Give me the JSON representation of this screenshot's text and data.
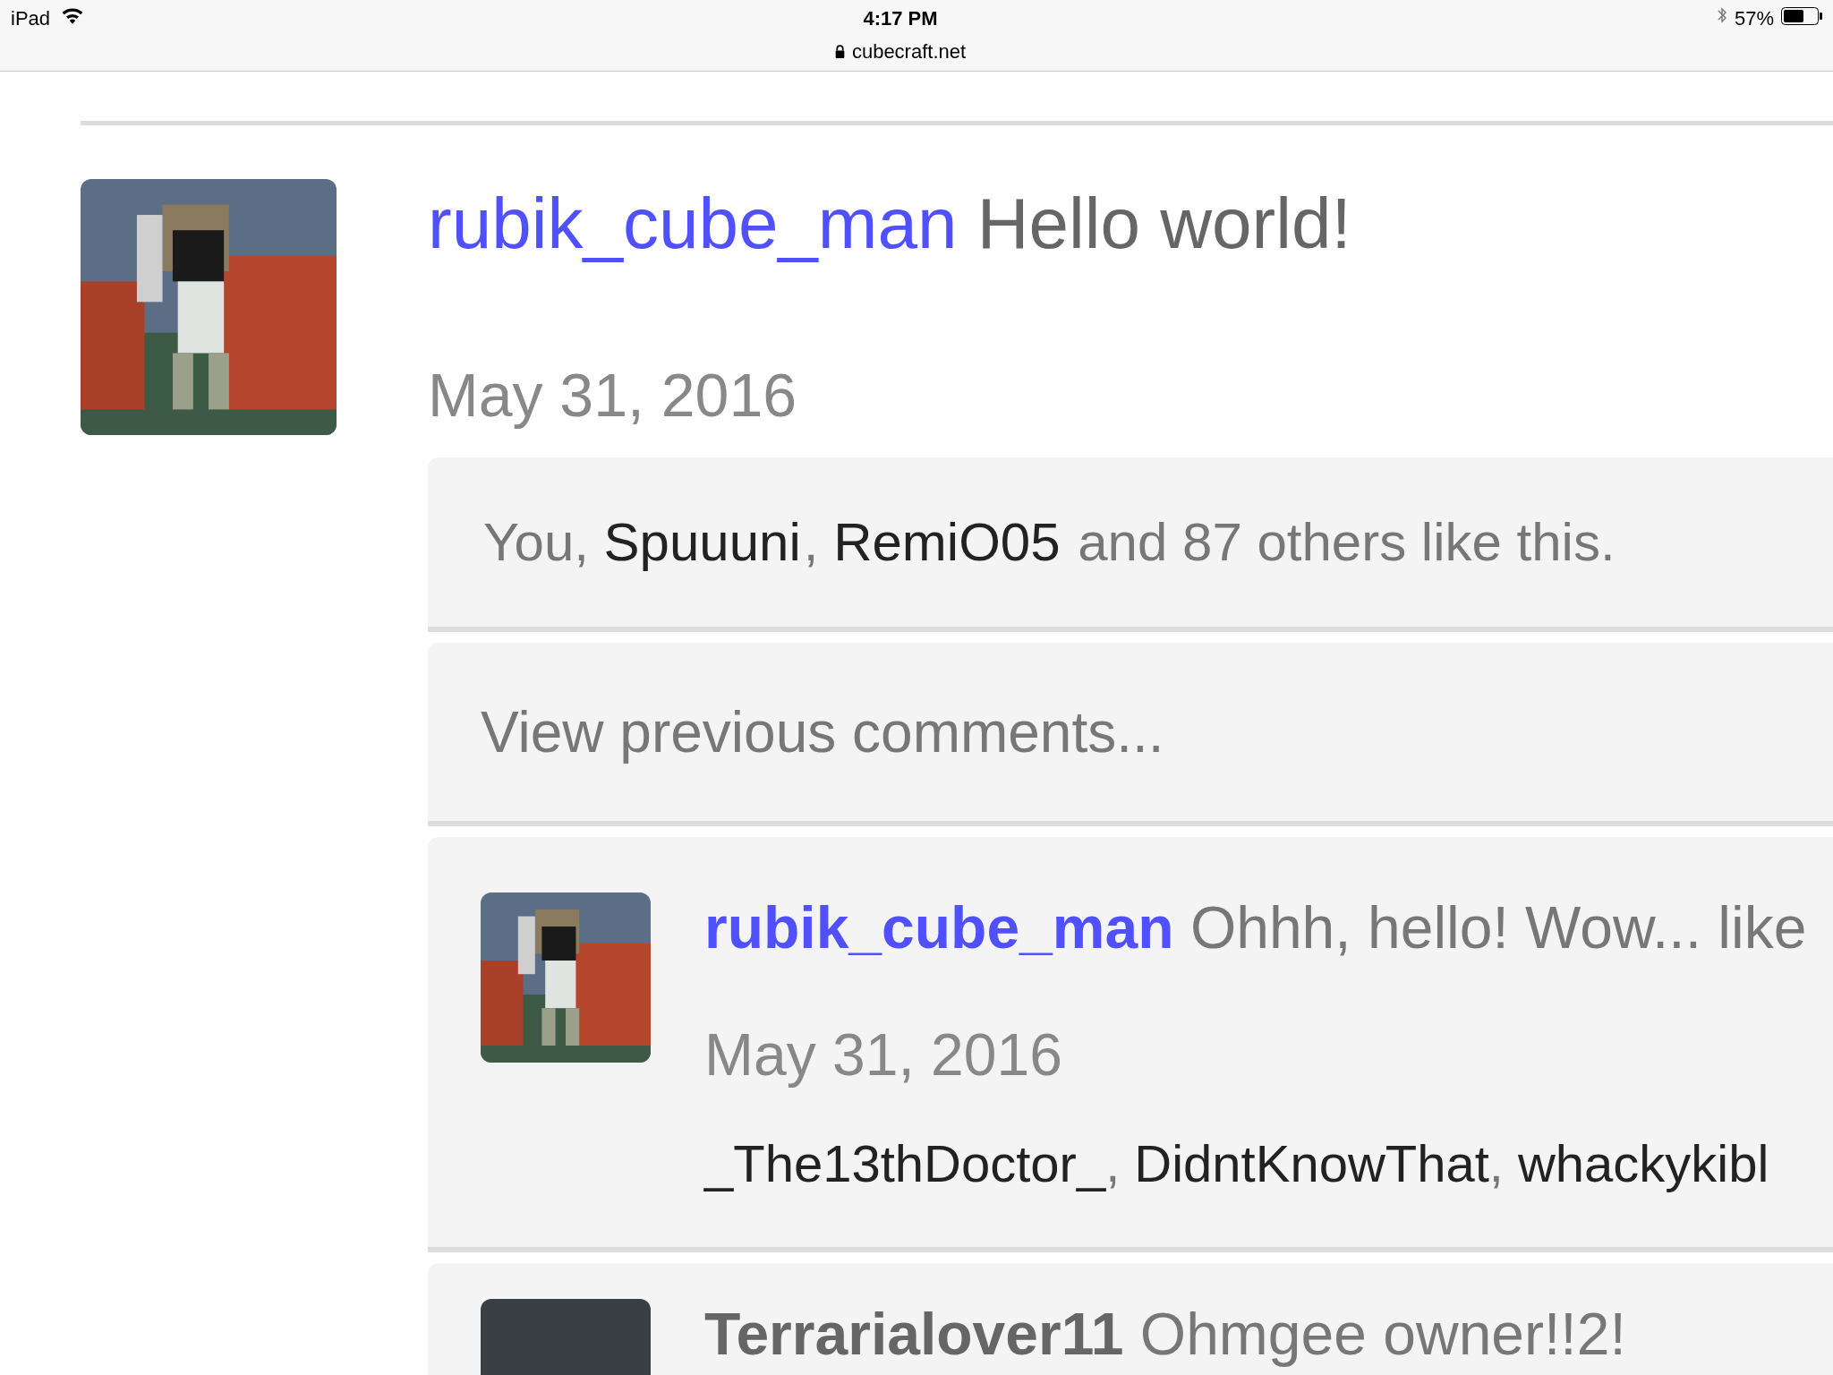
{
  "status_bar": {
    "device": "iPad",
    "time": "4:17 PM",
    "url": "cubecraft.net",
    "battery": "57%"
  },
  "post": {
    "author": "rubik_cube_man",
    "text": "Hello world!",
    "date": "May 31, 2016",
    "likes": [
      {
        "kind": "plain",
        "text": "You, "
      },
      {
        "kind": "link",
        "text": "Spuuuni"
      },
      {
        "kind": "plain",
        "text": ", "
      },
      {
        "kind": "link",
        "text": "RemiO05"
      },
      {
        "kind": "plain",
        "text": " and 87 others like this."
      }
    ],
    "view_previous": "View previous comments..."
  },
  "comments": [
    {
      "author": {
        "name": "rubik_cube_man",
        "kind": "link"
      },
      "text": "Ohhh, hello! Wow... like",
      "date": "May 31, 2016",
      "avatar": {
        "kind": "drawing"
      },
      "liked_by": [
        {
          "name": "_The13thDoctor_",
          "sep": ","
        },
        {
          "name": "DidntKnowThat",
          "sep": ","
        },
        {
          "name": "whackykibl"
        }
      ]
    },
    {
      "author": {
        "name": "Terrarialover11",
        "kind": "dark"
      },
      "text": "Ohmgee owner!!2!",
      "avatar": {
        "kind": "photo"
      }
    }
  ]
}
